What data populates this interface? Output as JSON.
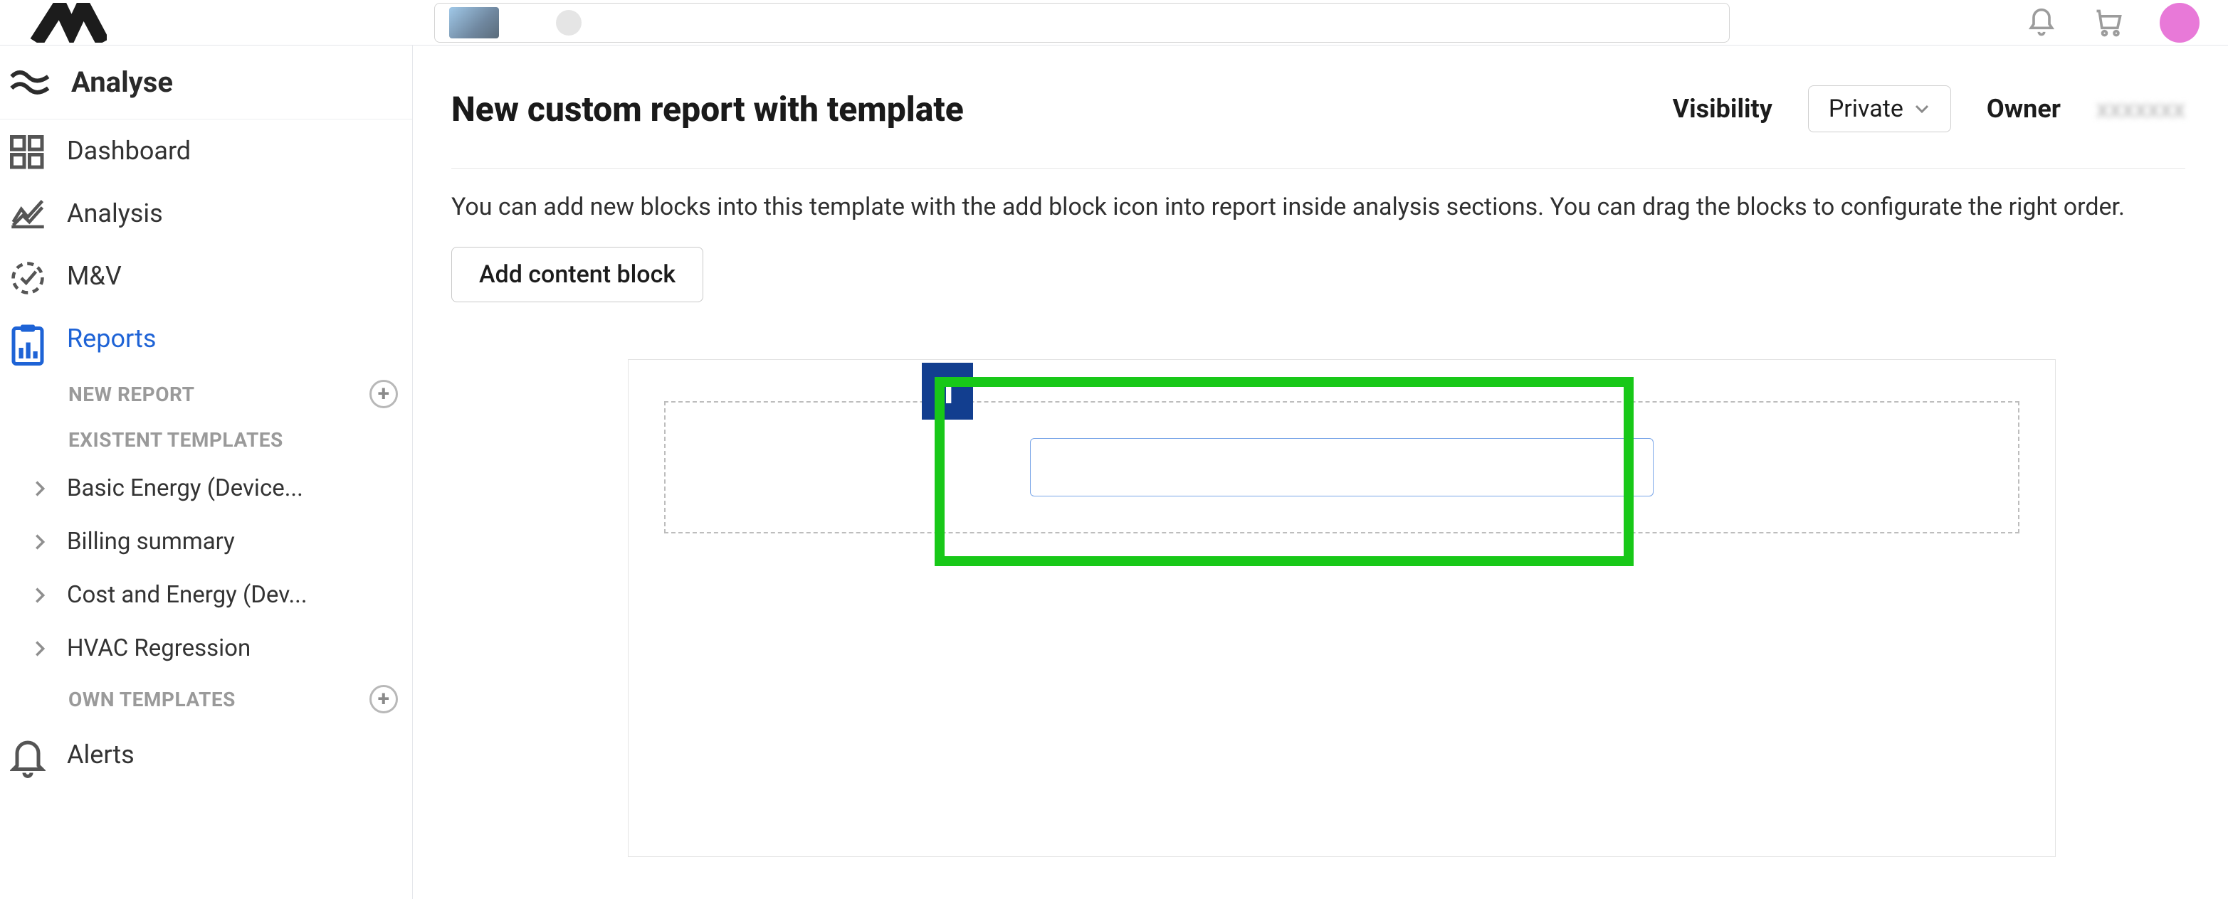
{
  "topbar": {
    "context_placeholder": "",
    "avatar_initial": ""
  },
  "sidebar": {
    "section_label": "Analyse",
    "items": [
      {
        "label": "Dashboard"
      },
      {
        "label": "Analysis"
      },
      {
        "label": "M&V"
      },
      {
        "label": "Reports"
      },
      {
        "label": "Alerts"
      }
    ],
    "new_report_heading": "NEW REPORT",
    "existent_templates_heading": "EXISTENT TEMPLATES",
    "own_templates_heading": "OWN TEMPLATES",
    "templates": [
      {
        "label": "Basic Energy (Device..."
      },
      {
        "label": "Billing summary"
      },
      {
        "label": "Cost and Energy (Dev..."
      },
      {
        "label": "HVAC Regression"
      }
    ]
  },
  "main": {
    "title": "New custom report with template",
    "visibility_label": "Visibility",
    "visibility_value": "Private",
    "owner_label": "Owner",
    "owner_value": "xxxxxxx",
    "description": "You can add new blocks into this template with the add block icon into report inside analysis sections. You can drag the blocks to configurate the right order.",
    "add_block_label": "Add content block",
    "annotation_badge": "1",
    "title_input_value": ""
  }
}
